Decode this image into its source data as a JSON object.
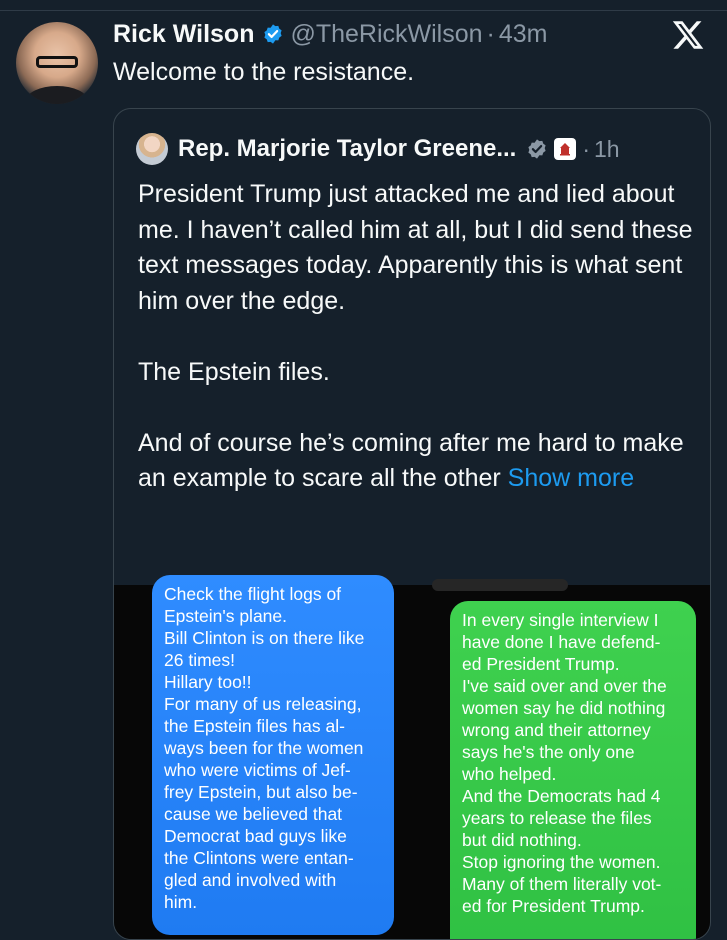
{
  "tweet": {
    "display_name": "Rick Wilson",
    "handle": "@TheRickWilson",
    "separator": "·",
    "time": "43m",
    "text": "Welcome to the resistance."
  },
  "quote": {
    "display_name": "Rep. Marjorie Taylor Greene...",
    "separator": "·",
    "time": "1h",
    "paragraphs": [
      "President Trump just attacked me and lied about me. I haven’t called him at all, but I did send these text messages today. Apparently this is what sent him over the edge.",
      "The Epstein files.",
      "And of course he’s coming after me hard to make an example to scare all the other"
    ],
    "show_more": "Show more",
    "media": {
      "blue_bubble_lines": [
        "Check the flight logs of",
        "Epstein's plane.",
        "Bill Clinton is on there like",
        "26 times!",
        "Hillary too!!",
        "For many of us releasing,",
        "the Epstein files has al-",
        "ways been for the women",
        "who were victims of Jef-",
        "frey Epstein, but also be-",
        "cause we believed that",
        "Democrat bad guys like",
        "the Clintons were entan-",
        "gled and involved with",
        "him."
      ],
      "green_bubble_lines": [
        "In every single interview I",
        "have done I have defend-",
        "ed President Trump.",
        "I've said over and over the",
        "women say he did nothing",
        "wrong and their attorney",
        "says he's the only one",
        "who helped.",
        "And the Democrats had 4",
        "years to release the files",
        "but did nothing.",
        "Stop ignoring the women.",
        "Many of them literally vot-",
        "ed for President Trump."
      ]
    }
  },
  "icons": {
    "verified": "verified-badge-icon",
    "x_logo": "x-logo-icon",
    "gov_badge": "government-verified-icon",
    "congress": "congress-flag-icon"
  },
  "colors": {
    "background": "#15202b",
    "accent": "#1d9bf0",
    "muted": "#8b98a5",
    "imessage_blue": "#1f7bf2",
    "sms_green": "#34c748"
  }
}
